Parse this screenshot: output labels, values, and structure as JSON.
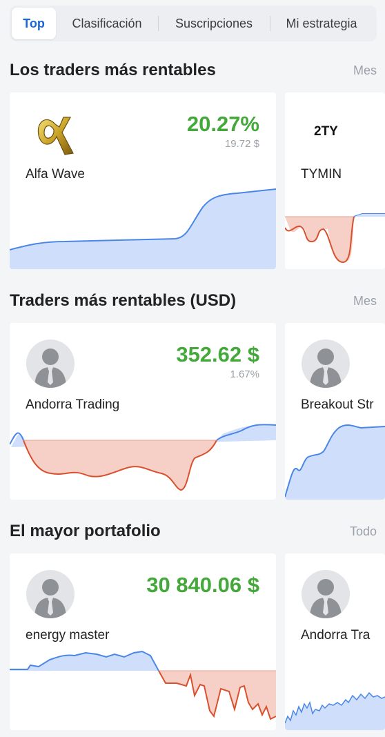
{
  "tabs": [
    {
      "label": "Top",
      "active": true
    },
    {
      "label": "Clasificación",
      "active": false
    },
    {
      "label": "Suscripciones",
      "active": false
    },
    {
      "label": "Mi estrategia",
      "active": false
    }
  ],
  "sections": [
    {
      "title": "Los traders más rentables",
      "link": "Mes",
      "cards": [
        {
          "name": "Alfa Wave",
          "primary": "20.27%",
          "secondary": "19.72 $",
          "avatar": "alfa-wave-logo"
        },
        {
          "name": "TYMIN",
          "logo_text": "2TY",
          "avatar": "tymin-logo"
        }
      ]
    },
    {
      "title": "Traders más rentables (USD)",
      "link": "Mes",
      "cards": [
        {
          "name": "Andorra Trading",
          "primary": "352.62 $",
          "secondary": "1.67%",
          "avatar": "default-person-avatar"
        },
        {
          "name": "Breakout Str",
          "avatar": "default-person-avatar"
        }
      ]
    },
    {
      "title": "El mayor portafolio",
      "link": "Todo",
      "cards": [
        {
          "name": "energy master",
          "primary": "30 840.06 $",
          "avatar": "default-person-avatar"
        },
        {
          "name": "Andorra Tra",
          "avatar": "default-person-avatar"
        }
      ]
    }
  ],
  "colors": {
    "accent_blue": "#1a66d8",
    "profit_green": "#44a83a",
    "chart_blue_line": "#4a86e8",
    "chart_blue_fill": "#cfdffb",
    "chart_red_line": "#d9502e",
    "chart_red_fill": "#f6cfc6"
  }
}
